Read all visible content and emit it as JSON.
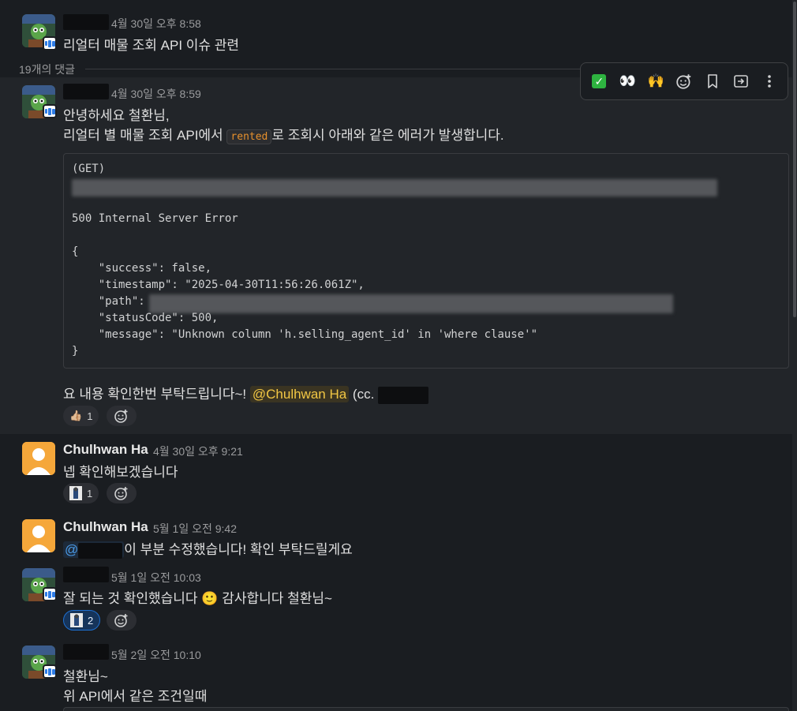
{
  "thread": {
    "reply_count_label": "19개의 댓글",
    "toolbar": {
      "icons": [
        "white-check-mark-icon",
        "eyes-icon",
        "raised-hands-icon",
        "add-reaction-icon",
        "bookmark-icon",
        "forward-icon",
        "more-icon"
      ]
    },
    "messages": [
      {
        "time": "4월 30일 오후 8:58",
        "text": "리얼터 매물 조회 API 이슈 관련"
      },
      {
        "time": "4월 30일 오후 8:59",
        "line1": "안녕하세요 철환님,",
        "line2_before": "리얼터 별 매물 조회 API에서 ",
        "line2_code": "rented",
        "line2_after": "로 조회시 아래와 같은 에러가 발생합니다.",
        "code": {
          "l1": "(GET)",
          "l3": "500 Internal Server Error",
          "l5": "{",
          "l6": "    \"success\": false,",
          "l7": "    \"timestamp\": \"2025-04-30T11:56:26.061Z\",",
          "l8": "    \"path\": ",
          "l9": "    \"statusCode\": 500,",
          "l10": "    \"message\": \"Unknown column 'h.selling_agent_id' in 'where clause'\"",
          "l11": "}"
        },
        "closing_before": "요 내용 확인한번 부탁드립니다~! ",
        "closing_mention": "@Chulhwan Ha",
        "closing_after": " (cc. ",
        "reaction": {
          "emoji": "👍🏼",
          "count": "1"
        }
      },
      {
        "author": "Chulhwan Ha",
        "time": "4월 30일 오후 9:21",
        "text": "넵 확인해보겠습니다",
        "reaction": {
          "count": "1"
        }
      },
      {
        "author": "Chulhwan Ha",
        "time": "5월 1일 오전 9:42",
        "mention_prefix": "@",
        "text_after": "이 부분 수정했습니다! 확인 부탁드릴게요"
      },
      {
        "time": "5월 1일 오전 10:03",
        "text_before": "잘 되는 것 확인했습니다 ",
        "emoji": "🙂",
        "text_after": " 감사합니다 철환님~",
        "reaction": {
          "count": "2"
        }
      },
      {
        "time": "5월 2일 오전 10:10",
        "line1": "철환님~",
        "line2": "위 API에서 같은 조건일때"
      }
    ]
  }
}
